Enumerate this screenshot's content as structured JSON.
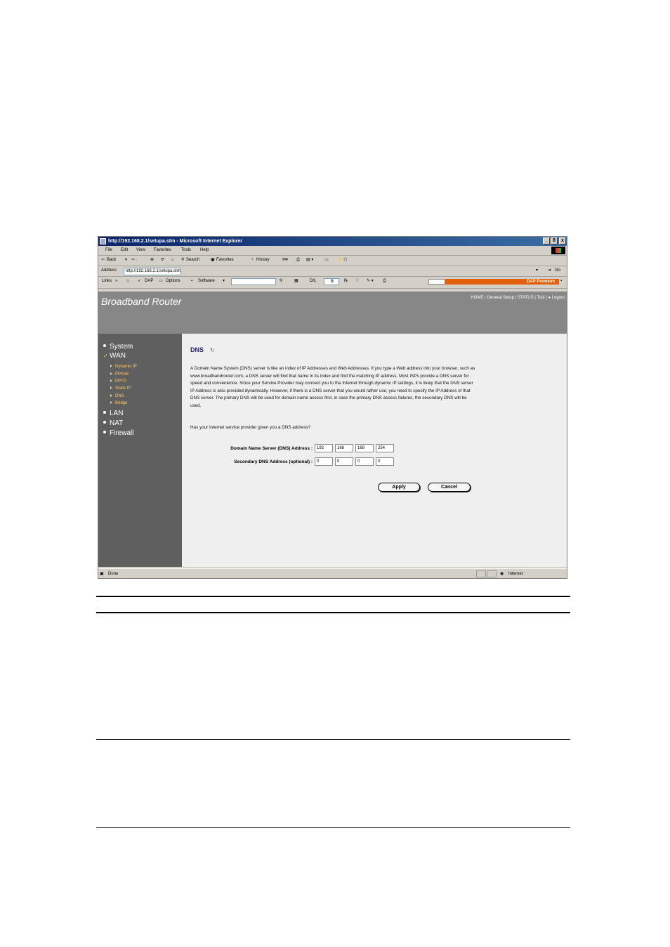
{
  "window": {
    "title": "http://192.168.2.1/setupa.stm - Microsoft Internet Explorer",
    "controls": [
      "_",
      "8",
      "x"
    ]
  },
  "menu": [
    "File",
    "Edit",
    "View",
    "Favorites",
    "Tools",
    "Help"
  ],
  "toolbar": {
    "back": "Back",
    "search": "Search",
    "favorites": "Favorites",
    "history": "History"
  },
  "address": {
    "label": "Address",
    "url": "http://192.168.2.1/setupa.stm",
    "go": "Go"
  },
  "links_bar": {
    "links": "Links",
    "dap": "DAP",
    "options": "Options",
    "software": "Software",
    "dl_label": "D/L",
    "dl_count": "0",
    "dap_premium": "DAP Premium"
  },
  "banner": {
    "brand": "Broadband Router",
    "nav": [
      "HOME",
      "General Setup",
      "STATUS",
      "Tool",
      "Logout"
    ]
  },
  "sidebar": {
    "items": [
      "System",
      "WAN",
      "LAN",
      "NAT",
      "Firewall"
    ],
    "wan_sub": [
      "Dynamic IP",
      "PPPoE",
      "PPTP",
      "Static IP",
      "DNS",
      "Bridge"
    ]
  },
  "dns": {
    "title": "DNS",
    "description": "A Domain Name System (DNS) server is like an index of IP Addresses and Web Addresses. If you type a Web address into your browser, such as www.broadbandrouter.com, a DNS server will find that name in its index and find the matching IP address. Most ISPs provide a DNS server for speed and convenience. Since your Service Provider may connect you to the Internet through dynamic IP settings, it is likely that the DNS server IP Address is also provided dynamically. However, if there is a DNS server that you would rather use, you need to specify the IP Address of that DNS server. The primary DNS will be used for domain name access first, in case the primary DNS access failures, the secondary DNS will be used.",
    "question": "Has your Internet service provider given you a DNS address?",
    "primary_label": "Domain Name Server (DNS) Address :",
    "primary": [
      "192",
      "168",
      "169",
      "254"
    ],
    "secondary_label": "Secondary DNS Address (optional) :",
    "secondary": [
      "0",
      "0",
      "0",
      "0"
    ],
    "apply": "Apply",
    "cancel": "Cancel"
  },
  "status": {
    "left": "Done",
    "zone": "Internet"
  }
}
